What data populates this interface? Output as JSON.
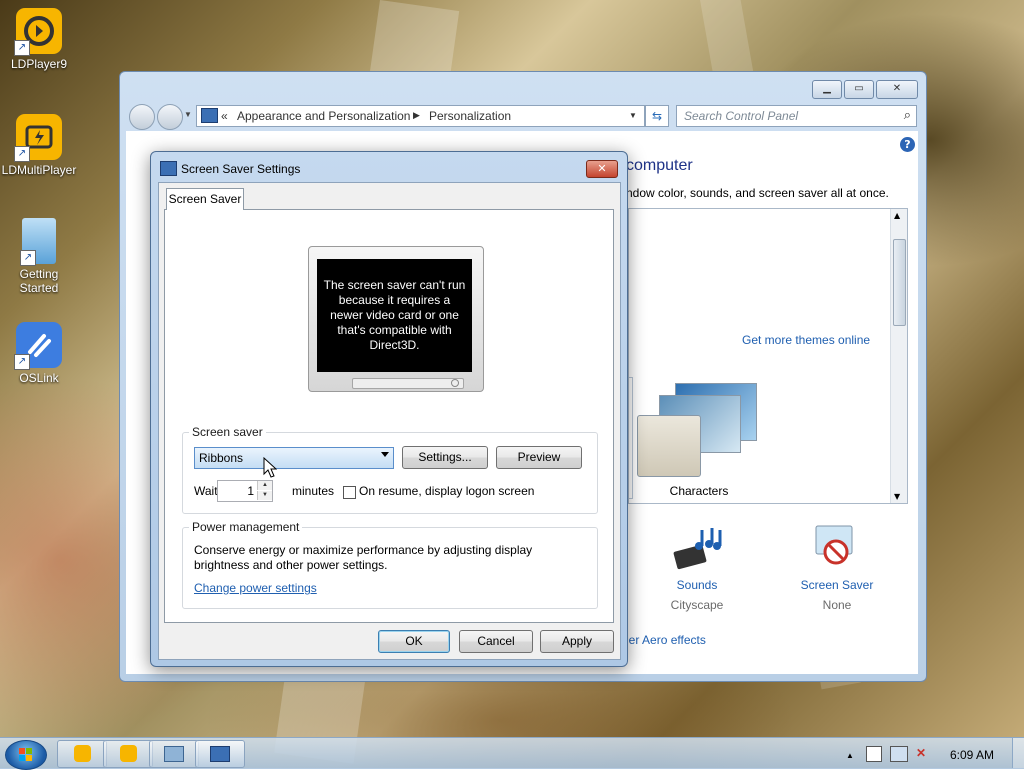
{
  "desktop": {
    "icons": [
      {
        "label": "LDPlayer9",
        "color": "#f7b500"
      },
      {
        "label": "LDMultiPlayer",
        "color": "#f7b500"
      },
      {
        "label_line1": "Getting",
        "label_line2": "Started",
        "color": "#6fb4e3"
      },
      {
        "label": "OSLink",
        "color": "#3d7de0"
      }
    ]
  },
  "control_panel": {
    "breadcrumb_prefix": "«",
    "breadcrumb": [
      "Appearance and Personalization",
      "Personalization"
    ],
    "search_placeholder": "Search Control Panel",
    "heading": "computer",
    "subtext": "ndow color, sounds, and screen saver all at once.",
    "get_more_themes": "Get more themes online",
    "theme_label": "Characters",
    "sounds": {
      "label": "Sounds",
      "value": "Cityscape"
    },
    "screen_saver": {
      "label": "Screen Saver",
      "value": "None"
    },
    "aero_link": "her Aero effects",
    "help_icon": "?"
  },
  "dialog": {
    "title": "Screen Saver Settings",
    "tab": "Screen Saver",
    "preview_message": "The screen saver can't run because it requires a newer video card or one that's compatible with Direct3D.",
    "screen_saver_group": "Screen saver",
    "selected_saver": "Ribbons",
    "settings_button": "Settings...",
    "preview_button": "Preview",
    "wait_label": "Wait:",
    "wait_value": "1",
    "minutes_label": "minutes",
    "on_resume_label": "On resume, display logon screen",
    "on_resume_checked": false,
    "power_group": "Power management",
    "power_text_line1": "Conserve energy or maximize performance by adjusting display",
    "power_text_line2": "brightness and other power settings.",
    "power_link": "Change power settings",
    "ok": "OK",
    "cancel": "Cancel",
    "apply": "Apply"
  },
  "taskbar": {
    "clock": "6:09 AM",
    "tray_expand": "▲"
  },
  "colors": {
    "link": "#1f5fb0",
    "heading": "#1e3287",
    "close_red": "#c4442e"
  }
}
